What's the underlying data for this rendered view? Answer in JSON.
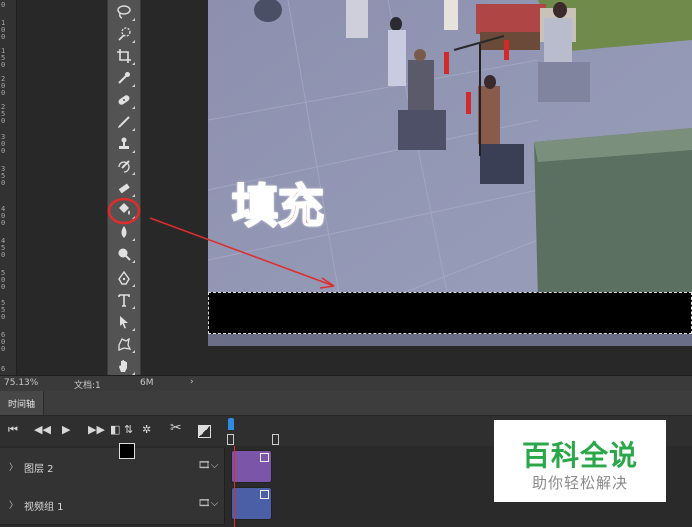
{
  "ruler": {
    "labels": [
      "0",
      "1\n0\n0",
      "1\n5\n0",
      "2\n0\n0",
      "2\n5\n0",
      "3\n0\n0",
      "3\n5\n0",
      "4\n0\n0",
      "4\n5\n0",
      "5\n0\n0",
      "5\n5\n0",
      "6\n0\n0",
      "6"
    ]
  },
  "annotation": {
    "text": "填充"
  },
  "statusbar": {
    "zoom": "75.13%",
    "doc_label": "文档:1",
    "doc_size": "6M",
    "arrow": "›"
  },
  "timeline": {
    "tab_label": "时间轴"
  },
  "tracks": [
    {
      "name": "图层 2",
      "clip_color": "#7b56a8"
    },
    {
      "name": "视频组 1",
      "clip_color": "#4a5fa6"
    }
  ],
  "watermark": {
    "main": "百科全说",
    "sub": "助你轻松解决"
  },
  "colors": {
    "annotation_red": "#e02c2c",
    "watermark_green": "#2aa748",
    "playhead": "#2f8be0"
  },
  "icons": {
    "tools": [
      "lasso-icon",
      "quick-select-icon",
      "crop-icon",
      "eyedropper-icon",
      "healing-brush-icon",
      "brush-icon",
      "clone-stamp-icon",
      "history-brush-icon",
      "eraser-icon",
      "paint-bucket-icon",
      "blur-icon",
      "dodge-icon",
      "pen-icon",
      "type-icon",
      "path-select-icon",
      "custom-shape-icon",
      "hand-icon",
      "zoom-icon",
      "more-tools-icon"
    ]
  }
}
